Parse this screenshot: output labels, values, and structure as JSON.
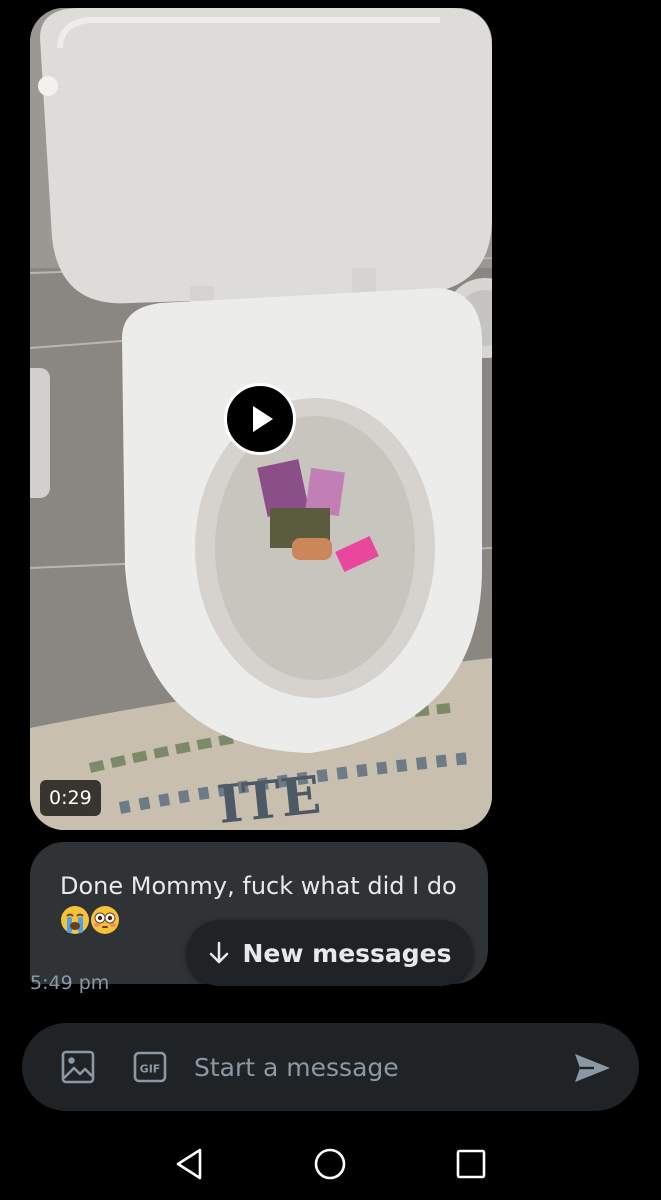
{
  "video": {
    "duration": "0:29",
    "play_icon": "play-icon"
  },
  "message": {
    "text": "Done Mommy, fuck what did I do",
    "emojis": [
      "loudly-crying-face",
      "flushed-face"
    ],
    "timestamp": "5:49 pm"
  },
  "new_messages_pill": {
    "label": "New messages",
    "icon": "arrow-down-icon"
  },
  "composer": {
    "placeholder": "Start a message",
    "icons": [
      "image-icon",
      "gif-icon",
      "send-icon"
    ],
    "gif_label": "GIF"
  },
  "navbar": {
    "icons": [
      "back-icon",
      "home-icon",
      "recents-icon"
    ]
  },
  "colors": {
    "background": "#000000",
    "bubble": "#2f3336",
    "composer": "#1f2326",
    "muted_text": "#8b98a5",
    "text": "#e7e9ea"
  }
}
